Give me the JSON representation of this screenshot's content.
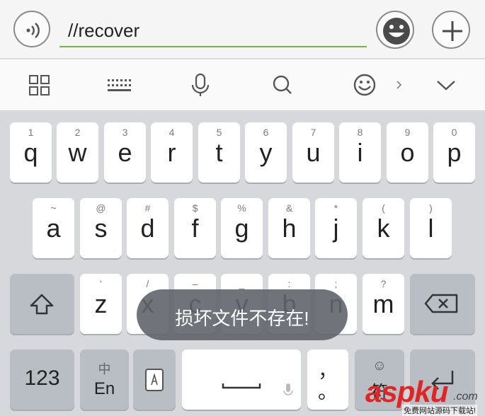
{
  "input_bar": {
    "text": "//recover",
    "voice_icon": "voice-message-icon",
    "emoji_icon": "smiley-face-icon",
    "add_icon": "plus-icon",
    "underline_color": "#6bbd3a"
  },
  "toolbar": {
    "icons": [
      "grid-icon",
      "keyboard-icon",
      "microphone-icon",
      "search-icon",
      "emoji-icon",
      "chevron-right-icon",
      "chevron-down-icon"
    ]
  },
  "keyboard": {
    "row1": [
      {
        "hint": "1",
        "key": "q"
      },
      {
        "hint": "2",
        "key": "w"
      },
      {
        "hint": "3",
        "key": "e"
      },
      {
        "hint": "4",
        "key": "r"
      },
      {
        "hint": "5",
        "key": "t"
      },
      {
        "hint": "6",
        "key": "y"
      },
      {
        "hint": "7",
        "key": "u"
      },
      {
        "hint": "8",
        "key": "i"
      },
      {
        "hint": "9",
        "key": "o"
      },
      {
        "hint": "0",
        "key": "p"
      }
    ],
    "row2": [
      {
        "hint": "~",
        "key": "a"
      },
      {
        "hint": "@",
        "key": "s"
      },
      {
        "hint": "#",
        "key": "d"
      },
      {
        "hint": "$",
        "key": "f"
      },
      {
        "hint": "%",
        "key": "g"
      },
      {
        "hint": "&",
        "key": "h"
      },
      {
        "hint": "*",
        "key": "j"
      },
      {
        "hint": "(",
        "key": "k"
      },
      {
        "hint": ")",
        "key": "l"
      }
    ],
    "row3": [
      {
        "hint": "'",
        "key": "z"
      },
      {
        "hint": "/",
        "key": "x"
      },
      {
        "hint": "–",
        "key": "c"
      },
      {
        "hint": "_",
        "key": "v"
      },
      {
        "hint": ":",
        "key": "b"
      },
      {
        "hint": ";",
        "key": "n"
      },
      {
        "hint": "?",
        "key": "m"
      }
    ],
    "numbers_key": "123",
    "lang_key_top": "中",
    "lang_key_bottom": "En",
    "punct_top": "，",
    "punct_bottom": "。",
    "symbol_key_top": "☺",
    "symbol_key_bottom": "符"
  },
  "toast": {
    "message": "损坏文件不存在!"
  },
  "watermark": {
    "logo": "aspku",
    "domain": ".com",
    "caption": "免费网站源码下载站!"
  }
}
